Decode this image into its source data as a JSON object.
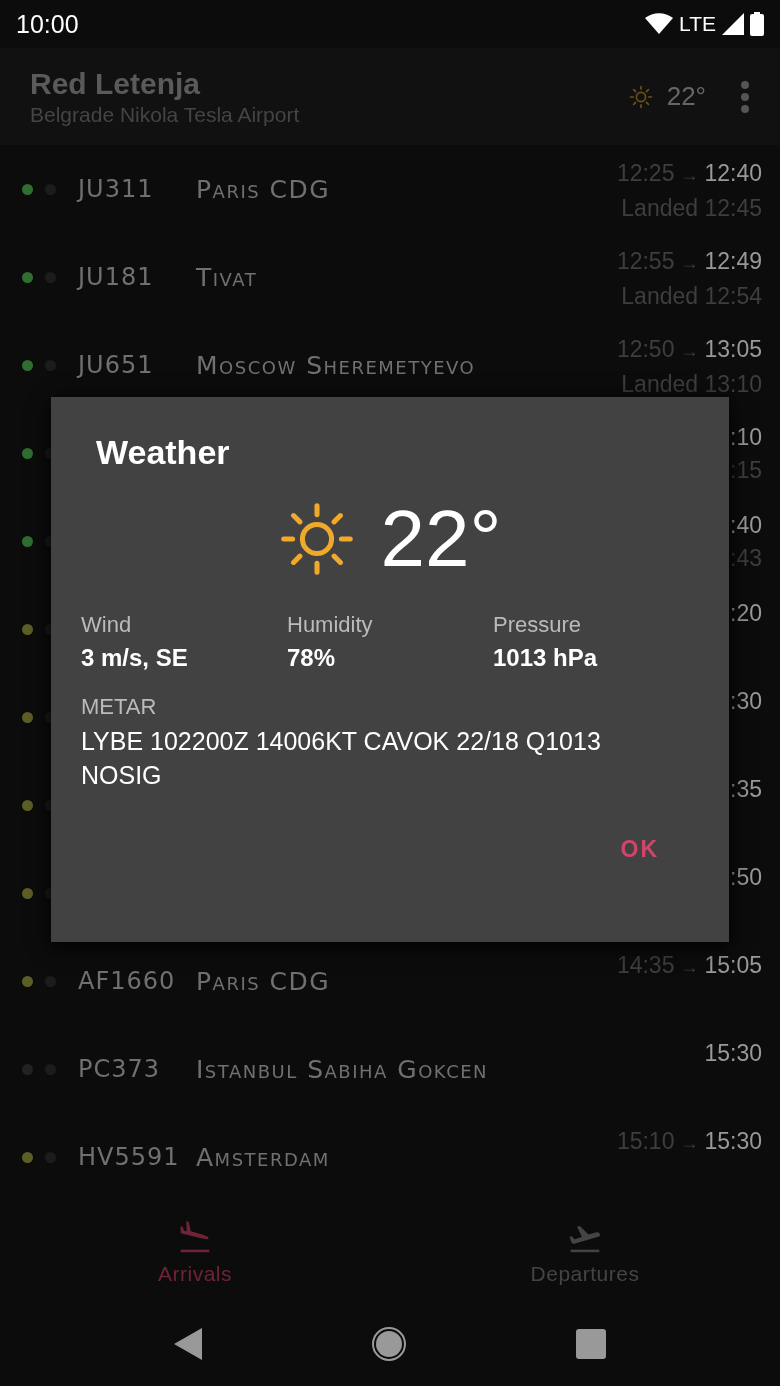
{
  "status_bar": {
    "time": "10:00",
    "network": "LTE"
  },
  "header": {
    "title": "Red Letenja",
    "subtitle": "Belgrade Nikola Tesla Airport",
    "temperature": "22°"
  },
  "flights": [
    {
      "color": "#2f6e2f",
      "flight": "JU311",
      "destination": "Paris CDG",
      "scheduled": "12:25",
      "arrow": "→",
      "actual": "12:40",
      "status": "Landed 12:45"
    },
    {
      "color": "#2f6e2f",
      "flight": "JU181",
      "destination": "Tivat",
      "scheduled": "12:55",
      "arrow": "→",
      "actual": "12:49",
      "status": "Landed 12:54"
    },
    {
      "color": "#2f6e2f",
      "flight": "JU651",
      "destination": "Moscow Sheremetyevo",
      "scheduled": "12:50",
      "arrow": "→",
      "actual": "13:05",
      "status": "Landed 13:10"
    },
    {
      "color": "#2f6e2f",
      "actual": ":10",
      "status": ":15"
    },
    {
      "color": "#2f6e2f",
      "actual": ":40",
      "status": ":43"
    },
    {
      "color": "#5c5e24",
      "actual": ":20"
    },
    {
      "color": "#5c5e24",
      "actual": ":30"
    },
    {
      "color": "#5c5e24",
      "actual": ":35"
    },
    {
      "color": "#5c5e24",
      "actual": ":50"
    },
    {
      "color": "#5c5e24",
      "flight": "AF1660",
      "destination": "Paris CDG",
      "scheduled": "14:35",
      "arrow": "→",
      "actual": "15:05"
    },
    {
      "color": "#222222",
      "flight": "PC373",
      "destination": "Istanbul Sabiha Gokcen",
      "actual": "15:30"
    },
    {
      "color": "#5c5e24",
      "flight": "HV5591",
      "destination": "Amsterdam",
      "scheduled": "15:10",
      "arrow": "→",
      "actual": "15:30"
    }
  ],
  "tabs": [
    {
      "label": "Arrivals",
      "kind": "arrivals",
      "selected": true
    },
    {
      "label": "Departures",
      "kind": "departures",
      "selected": false
    }
  ],
  "dialog": {
    "title": "Weather",
    "temperature": "22°",
    "stats": [
      {
        "label": "Wind",
        "value": "3 m/s, SE"
      },
      {
        "label": "Humidity",
        "value": "78%"
      },
      {
        "label": "Pressure",
        "value": "1013 hPa"
      }
    ],
    "metar_label": "METAR",
    "metar": "LYBE 102200Z 14006KT CAVOK 22/18 Q1013 NOSIG",
    "button": "OK"
  }
}
